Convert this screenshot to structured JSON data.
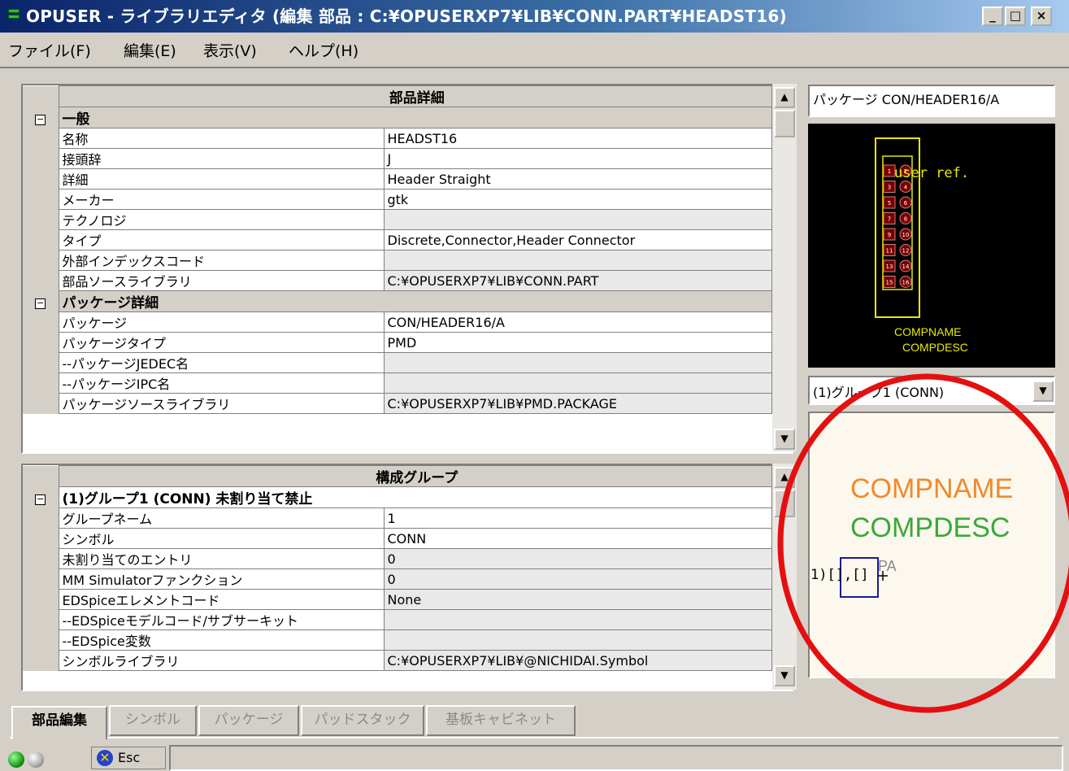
{
  "window": {
    "title": "OPUSER - ライブラリエディタ (編集 部品 : C:¥OPUSERXP7¥LIB¥CONN.PART¥HEADST16)",
    "minimize_label": "_",
    "maximize_label": "□",
    "close_label": "×"
  },
  "menu": [
    "ファイル(F)",
    "編集(E)",
    "表示(V)",
    "ヘルプ(H)"
  ],
  "details": {
    "header": "部品詳細",
    "general_label": "一般",
    "general_rows": [
      {
        "name": "名称",
        "value": "HEADST16"
      },
      {
        "name": "接頭辞",
        "value": "J"
      },
      {
        "name": "詳細",
        "value": "Header Straight"
      },
      {
        "name": "メーカー",
        "value": "gtk"
      },
      {
        "name": "テクノロジ",
        "value": ""
      },
      {
        "name": "タイプ",
        "value": "Discrete,Connector,Header Connector"
      },
      {
        "name": "外部インデックスコード",
        "value": ""
      },
      {
        "name": "部品ソースライブラリ",
        "value": "C:¥OPUSERXP7¥LIB¥CONN.PART"
      }
    ],
    "package_label": "パッケージ詳細",
    "package_rows": [
      {
        "name": "パッケージ",
        "value": "CON/HEADER16/A"
      },
      {
        "name": "パッケージタイプ",
        "value": "PMD"
      },
      {
        "name": "--パッケージJEDEC名",
        "value": ""
      },
      {
        "name": "--パッケージIPC名",
        "value": ""
      },
      {
        "name": "パッケージソースライブラリ",
        "value": "C:¥OPUSERXP7¥LIB¥PMD.PACKAGE"
      }
    ]
  },
  "groups": {
    "header": "構成グループ",
    "group_label": "(1)グループ1 (CONN) 未割り当て禁止",
    "rows": [
      {
        "name": "グループネーム",
        "value": "1"
      },
      {
        "name": "シンボル",
        "value": "CONN"
      },
      {
        "name": "未割り当てのエントリ",
        "value": "0"
      },
      {
        "name": "MM Simulatorファンクション",
        "value": " 0"
      },
      {
        "name": "EDSpiceエレメントコード",
        "value": "None"
      },
      {
        "name": "--EDSpiceモデルコード/サブサーキット",
        "value": ""
      },
      {
        "name": "--EDSpice変数",
        "value": ""
      },
      {
        "name": "シンボルライブラリ",
        "value": "C:¥OPUSERXP7¥LIB¥@NICHIDAI.Symbol"
      }
    ]
  },
  "preview": {
    "package_label": "パッケージ CON/HEADER16/A",
    "footprint_ref_text": "user ref.",
    "footprint_compname": "COMPNAME",
    "footprint_compdesc": "COMPDESC",
    "pad_labels_left": [
      "1",
      "3",
      "5",
      "7",
      "9",
      "11",
      "13",
      "15"
    ],
    "pad_labels_right": [
      "2",
      "4",
      "6",
      "8",
      "10",
      "12",
      "14",
      "16"
    ],
    "group_select_value": "(1)グループ1 (CONN)",
    "symbol_compname": "COMPNAME",
    "symbol_compdesc": "COMPDESC",
    "symbol_pin_text": "1)[],[]",
    "symbol_pa_text": "PA",
    "colors": {
      "compname": "#f08a2a",
      "compdesc": "#3aa83a",
      "highlight_circle": "#e41010"
    }
  },
  "tabs": [
    "部品編集",
    "シンボル",
    "パッケージ",
    "パッドスタック",
    "基板キャビネット"
  ],
  "status": {
    "esc_label": "Esc"
  }
}
